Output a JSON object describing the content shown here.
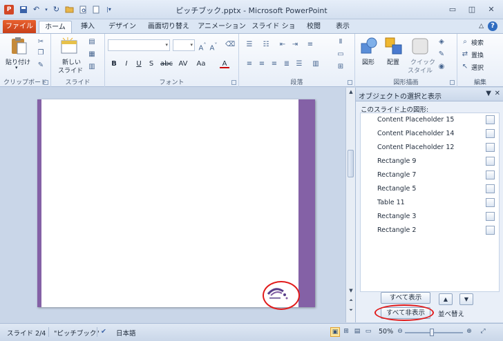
{
  "app": {
    "icon_letter": "P",
    "title": "ピッチブック.pptx - Microsoft PowerPoint"
  },
  "qat": [
    "save-icon",
    "undo-icon",
    "redo-icon",
    "open-icon",
    "preview-icon",
    "new-icon",
    "customize-icon"
  ],
  "tabs": {
    "file": "ファイル",
    "items": [
      "ホーム",
      "挿入",
      "デザイン",
      "画面切り替え",
      "アニメーション",
      "スライド ショー",
      "校閲",
      "表示"
    ],
    "active": "ホーム"
  },
  "ribbon": {
    "clipboard": {
      "label": "クリップボード",
      "paste": "貼り付け"
    },
    "slides": {
      "label": "スライド",
      "new_slide_line1": "新しい",
      "new_slide_line2": "スライド"
    },
    "font": {
      "label": "フォント"
    },
    "paragraph": {
      "label": "段落"
    },
    "drawing": {
      "label": "図形描画",
      "shape": "図形",
      "arrange": "配置",
      "quick_style_line1": "クイック",
      "quick_style_line2": "スタイル"
    },
    "editing": {
      "label": "編集",
      "find": "検索",
      "replace": "置換",
      "select": "選択"
    }
  },
  "pane": {
    "title": "オブジェクトの選択と表示",
    "shapes_label": "このスライド上の図形:",
    "items": [
      "Content Placeholder 15",
      "Content Placeholder 14",
      "Content Placeholder 12",
      "Rectangle 9",
      "Rectangle 7",
      "Rectangle 5",
      "Table 11",
      "Rectangle 3",
      "Rectangle 2"
    ],
    "show_all": "すべて表示",
    "hide_all": "すべて非表示",
    "reorder": "並べ替え"
  },
  "status": {
    "slide": "スライド 2/4",
    "theme": "\"ピッチブック\"",
    "language": "日本語",
    "zoom": "50%",
    "zoom_level": 0.5
  },
  "colors": {
    "accent_purple": "#8461a6",
    "file_tab": "#d24726",
    "annotation_red": "#e11a1a"
  }
}
